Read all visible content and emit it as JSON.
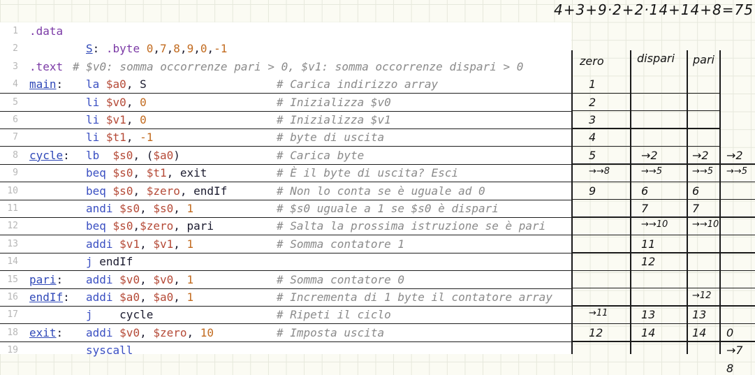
{
  "handwritten_total": "4+3+9·2+2·14+14+8=75",
  "columns": [
    "zero",
    "dispari",
    "pari"
  ],
  "code": [
    {
      "n": "1",
      "label": "",
      "instr": ".data",
      "comment": ""
    },
    {
      "n": "2",
      "label": "",
      "instr": "S: .byte 0,7,8,9,0,-1",
      "comment": ""
    },
    {
      "n": "3",
      "label": "",
      "instr": ".text",
      "comment": "# $v0: somma occorrenze pari > 0, $v1: somma occorrenze dispari > 0"
    },
    {
      "n": "4",
      "label": "main:",
      "instr": "la $a0, S",
      "comment": "# Carica indirizzo array"
    },
    {
      "n": "5",
      "label": "",
      "instr": "li $v0, 0",
      "comment": "# Inizializza $v0"
    },
    {
      "n": "6",
      "label": "",
      "instr": "li $v1, 0",
      "comment": "# Inizializza $v1"
    },
    {
      "n": "7",
      "label": "",
      "instr": "li $t1, -1",
      "comment": "# byte di uscita"
    },
    {
      "n": "8",
      "label": "cycle:",
      "instr": "lb  $s0, ($a0)",
      "comment": "# Carica byte"
    },
    {
      "n": "9",
      "label": "",
      "instr": "beq $s0, $t1, exit",
      "comment": "# È il byte di uscita? Esci"
    },
    {
      "n": "10",
      "label": "",
      "instr": "beq $s0, $zero, endIf",
      "comment": "# Non lo conta se è uguale ad 0"
    },
    {
      "n": "11",
      "label": "",
      "instr": "andi $s0, $s0, 1",
      "comment": "# $s0 uguale a 1 se $s0 è dispari"
    },
    {
      "n": "12",
      "label": "",
      "instr": "beq $s0,$zero, pari",
      "comment": "# Salta la prossima istruzione se è pari"
    },
    {
      "n": "13",
      "label": "",
      "instr": "addi $v1, $v1, 1",
      "comment": "# Somma contatore 1"
    },
    {
      "n": "14",
      "label": "",
      "instr": "j endIf",
      "comment": ""
    },
    {
      "n": "15",
      "label": "pari:",
      "instr": "addi $v0, $v0, 1",
      "comment": "# Somma contatore 0"
    },
    {
      "n": "16",
      "label": "endIf:",
      "instr": "addi $a0, $a0, 1",
      "comment": "# Incrementa di 1 byte il contatore array"
    },
    {
      "n": "17",
      "label": "",
      "instr": "j    cycle",
      "comment": "# Ripeti il ciclo"
    },
    {
      "n": "18",
      "label": "exit:",
      "instr": "addi $v0, $zero, 10",
      "comment": "# Imposta uscita"
    },
    {
      "n": "19",
      "label": "",
      "instr": "syscall",
      "comment": ""
    }
  ],
  "trace": {
    "zero": [
      "1",
      "2",
      "3",
      "4",
      "5",
      "→→8",
      "9",
      "",
      "",
      "",
      "",
      "",
      "",
      "→11",
      "12",
      "",
      ""
    ],
    "dispari": [
      "",
      "",
      "",
      "",
      "→2",
      "→→5",
      "6",
      "7",
      "→→10",
      "11",
      "12",
      "",
      "",
      "13",
      "14",
      "",
      ""
    ],
    "pari": [
      "",
      "",
      "",
      "",
      "→2",
      "→→5",
      "6",
      "7",
      "→→10",
      "",
      "",
      "",
      "→12",
      "13",
      "14",
      "",
      ""
    ],
    "fourth": [
      "",
      "",
      "",
      "",
      "→2",
      "→→5",
      "",
      "",
      "",
      "",
      "",
      "",
      "",
      "",
      "0",
      "→7",
      "8"
    ]
  }
}
